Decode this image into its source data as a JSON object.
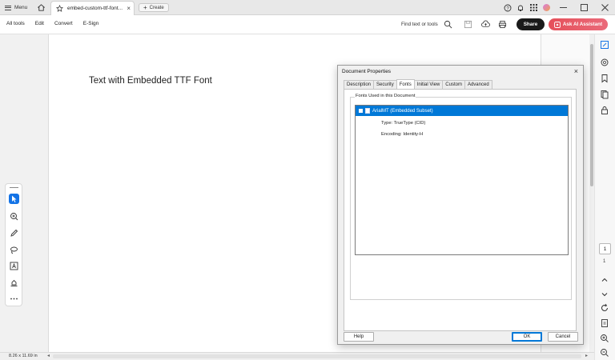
{
  "titlebar": {
    "menu_label": "Menu",
    "tab_title": "embed-custom-ttf-font...",
    "tab_close": "×",
    "create_label": "Create"
  },
  "toolbar": {
    "menus": [
      "All tools",
      "Edit",
      "Convert",
      "E-Sign"
    ],
    "find_label": "Find text or tools",
    "share_label": "Share",
    "ai_label": "Ask AI Assistant"
  },
  "document": {
    "text": "Text with Embedded TTF Font"
  },
  "statusbar": {
    "page_size": "8.26 x 11.69 in"
  },
  "page_nav": {
    "current": "1",
    "total": "1"
  },
  "dialog": {
    "title": "Document Properties",
    "close": "×",
    "tabs": [
      {
        "label": "Description"
      },
      {
        "label": "Security"
      },
      {
        "label": "Fonts"
      },
      {
        "label": "Initial View"
      },
      {
        "label": "Custom"
      },
      {
        "label": "Advanced"
      }
    ],
    "group_label": "Fonts Used in this Document",
    "font_name": "ArialMT (Embedded Subset)",
    "font_type": "Type: TrueType (CID)",
    "font_encoding": "Encoding: Identity-H",
    "help_label": "Help",
    "ok_label": "OK",
    "cancel_label": "Cancel"
  },
  "colors": {
    "accent": "#1473e6",
    "ai_button": "#e5505a",
    "selection": "#0078d7"
  }
}
